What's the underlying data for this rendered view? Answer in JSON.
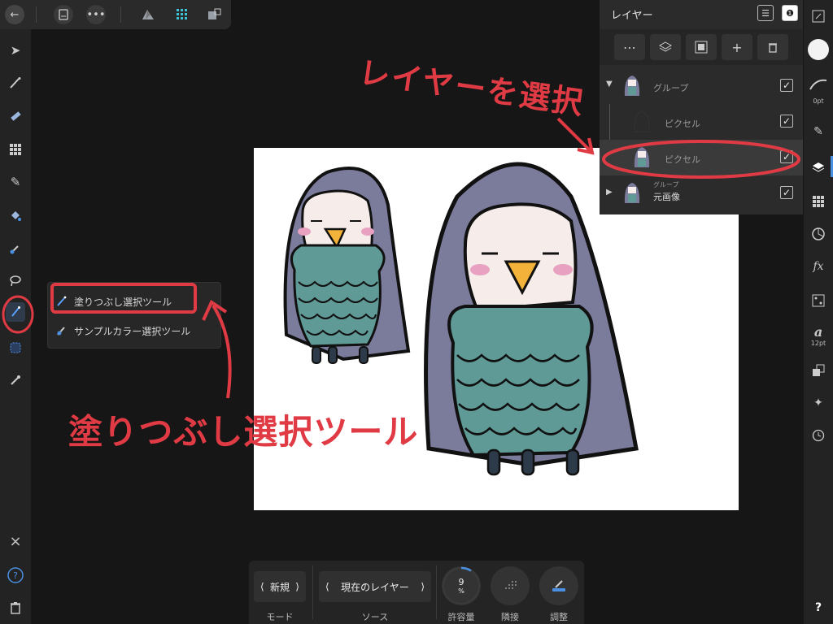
{
  "top_bar": {
    "back_icon": "back-arrow-icon",
    "document_icon": "document-icon",
    "more_icon": "more-dots-icon"
  },
  "flyout": {
    "item1": "塗りつぶし選択ツール",
    "item2": "サンプルカラー選択ツール"
  },
  "layers": {
    "title": "レイヤー",
    "rows": [
      {
        "name": "グループ"
      },
      {
        "name": "ピクセル"
      },
      {
        "name": "ピクセル"
      },
      {
        "name_top": "グループ",
        "name": "元画像"
      }
    ]
  },
  "right_bar": {
    "brush_size": "0pt",
    "font_size": "12pt",
    "help": "?"
  },
  "context": {
    "mode_value": "新規",
    "mode_label": "モード",
    "source_value": "現在のレイヤー",
    "source_label": "ソース",
    "tolerance_value": "9",
    "tolerance_unit": "%",
    "tolerance_label": "許容量",
    "contiguous_label": "隣接",
    "refine_label": "調整"
  },
  "annotations": {
    "select_layer": "レイヤーを選択",
    "flood_tool": "塗りつぶし選択ツール"
  },
  "colors": {
    "accent": "#4a90e2",
    "annotation": "#e03b44",
    "hair": "#7b7b9c",
    "scales": "#5f9a97",
    "beak": "#f3b23a"
  }
}
